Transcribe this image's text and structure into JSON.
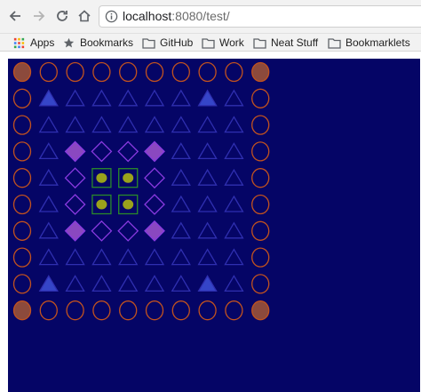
{
  "browser": {
    "url_host": "localhost",
    "url_rest": ":8080/test/"
  },
  "bookmarks": [
    {
      "label": "Apps",
      "icon": "apps-grid-icon"
    },
    {
      "label": "Bookmarks",
      "icon": "star-icon"
    },
    {
      "label": "GitHub",
      "icon": "folder-icon"
    },
    {
      "label": "Work",
      "icon": "folder-icon"
    },
    {
      "label": "Neat Stuff",
      "icon": "folder-icon"
    },
    {
      "label": "Bookmarklets",
      "icon": "folder-icon"
    }
  ],
  "game": {
    "background": "#050566",
    "grid": [
      "CCCCCCCCCC",
      "CTtttttTC",
      "CtttttttC",
      "CtDddDtC",
      "CtdSSdtC",
      "CtdSSdtC",
      "CtDddDtC",
      "CtttttttC",
      "CTtttttTC",
      "CCCCCCCCCC"
    ],
    "legend": {
      "C": "empty-orange-circle",
      "T": "filled-blue-triangle",
      "t": "empty-blue-triangle",
      "D": "filled-purple-diamond",
      "d": "empty-purple-diamond",
      "S": "green-square-with-olive-blob"
    },
    "corner_circles": "filled",
    "colors": {
      "circle": "#c2521e",
      "circle_fill": "#8c4a3c",
      "triangle": "#2f2fb0",
      "triangle_fill": "#3545c8",
      "diamond": "#8a3ae0",
      "diamond_fill": "#8a48c0",
      "square": "#2a8a2a",
      "blob": "#9aa21c"
    }
  }
}
